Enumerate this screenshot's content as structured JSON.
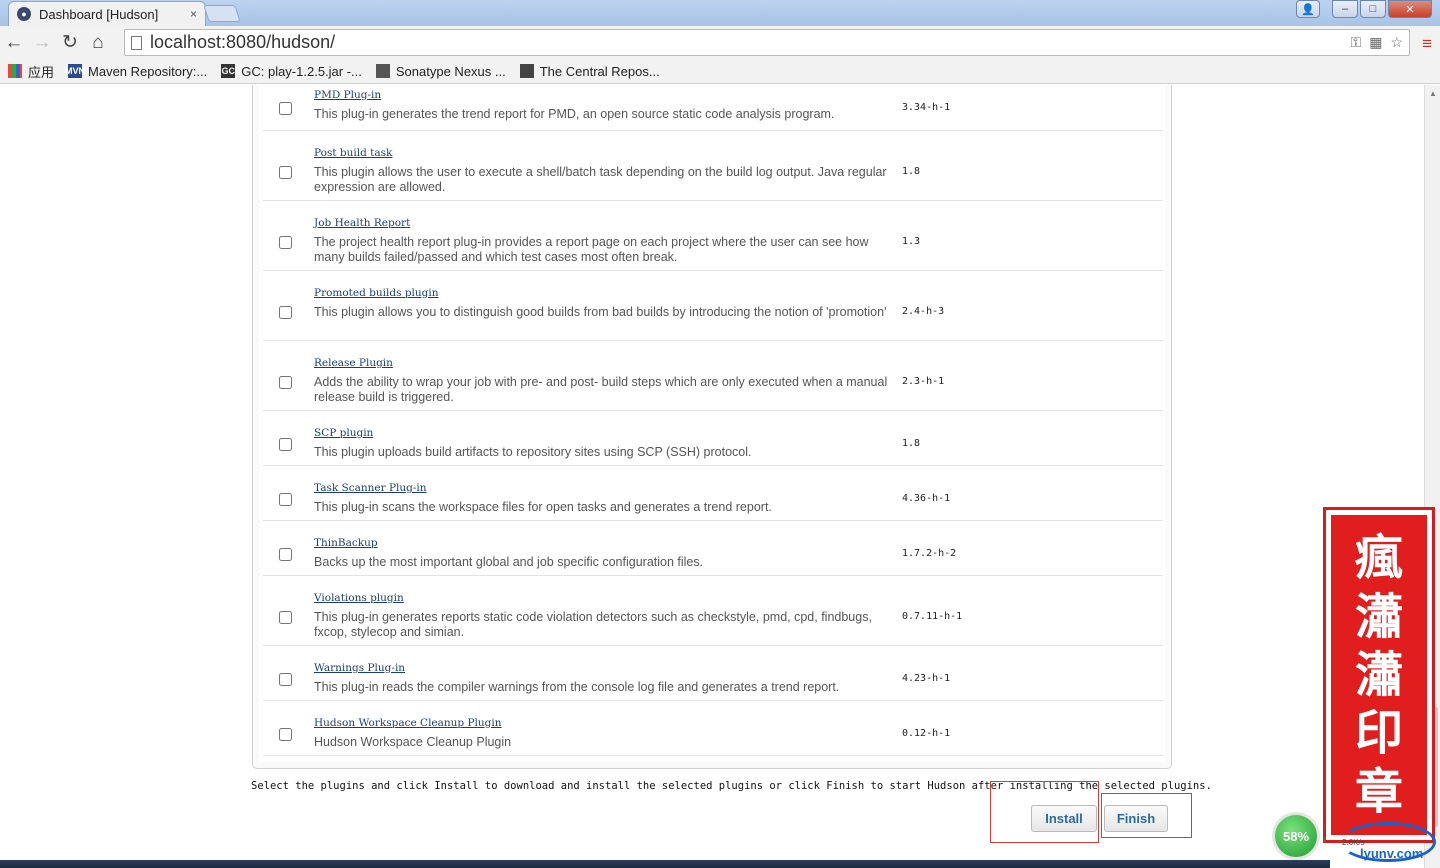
{
  "browser": {
    "tab_title": "Dashboard [Hudson]",
    "tab_close": "×",
    "url": "localhost:8080/hudson/",
    "controls": {
      "back": "←",
      "forward": "→",
      "reload": "↻",
      "home": "⌂",
      "menu": "≡",
      "star": "☆"
    },
    "window_buttons": {
      "user": "👤",
      "minimize": "–",
      "maximize": "□",
      "close": "✕"
    },
    "bookmarks": [
      {
        "label": "应用",
        "icon": "apps-icon"
      },
      {
        "label": "Maven Repository:...",
        "icon": "maven-icon",
        "badge": "MVN"
      },
      {
        "label": "GC: play-1.2.5.jar -...",
        "icon": "gc-icon",
        "badge": "GC"
      },
      {
        "label": "Sonatype Nexus ...",
        "icon": "nexus-icon"
      },
      {
        "label": "The Central Repos...",
        "icon": "repo-icon"
      }
    ]
  },
  "plugins": [
    {
      "name": "PMD Plug-in",
      "description": "This plug-in generates the trend report for PMD, an open source static code analysis program.",
      "version": "3.34-h-1"
    },
    {
      "name": "Post build task",
      "description": "This plugin allows the user to execute a shell/batch task depending on the build log output. Java regular expression are allowed.",
      "version": "1.8"
    },
    {
      "name": "Job Health Report",
      "description": "The project health report plug-in provides a report page on each project where the user can see how many builds failed/passed and which test cases most often break.",
      "version": "1.3"
    },
    {
      "name": "Promoted builds plugin",
      "description": "This plugin allows you to distinguish good builds from bad builds by introducing the notion of 'promotion'",
      "version": "2.4-h-3"
    },
    {
      "name": "Release Plugin",
      "description": "Adds the ability to wrap your job with pre- and post- build steps which are only executed when a manual release build is triggered.",
      "version": "2.3-h-1"
    },
    {
      "name": "SCP plugin",
      "description": "This plugin uploads build artifacts to repository sites using SCP (SSH) protocol.",
      "version": "1.8"
    },
    {
      "name": "Task Scanner Plug-in",
      "description": "This plug-in scans the workspace files for open tasks and generates a trend report.",
      "version": "4.36-h-1"
    },
    {
      "name": "ThinBackup",
      "description": "Backs up the most important global and job specific configuration files.",
      "version": "1.7.2-h-2"
    },
    {
      "name": "Violations plugin",
      "description": "This plug-in generates reports static code violation detectors such as checkstyle, pmd, cpd, findbugs, fxcop, stylecop and simian.",
      "version": "0.7.11-h-1"
    },
    {
      "name": "Warnings Plug-in",
      "description": "This plug-in reads the compiler warnings from the console log file and generates a trend report.",
      "version": "4.23-h-1"
    },
    {
      "name": "Hudson Workspace Cleanup Plugin",
      "description": "Hudson Workspace Cleanup Plugin",
      "version": "0.12-h-1"
    }
  ],
  "instructions": "Select the plugins and click Install to download and install the selected plugins or click Finish to start Hudson after installing the selected plugins.",
  "buttons": {
    "install": "Install",
    "finish": "Finish"
  },
  "overlay": {
    "seal_chars": [
      "瘋",
      "瀟",
      "瀟",
      "印",
      "章"
    ],
    "network_percent": "58%",
    "speed": "2.6K/s",
    "watermark": "lyunv.com"
  },
  "colors": {
    "link": "#1a3f6e",
    "button_text": "#2e6b9e",
    "seal": "#e01e1e",
    "highlight_frame": "#d83a3a"
  }
}
